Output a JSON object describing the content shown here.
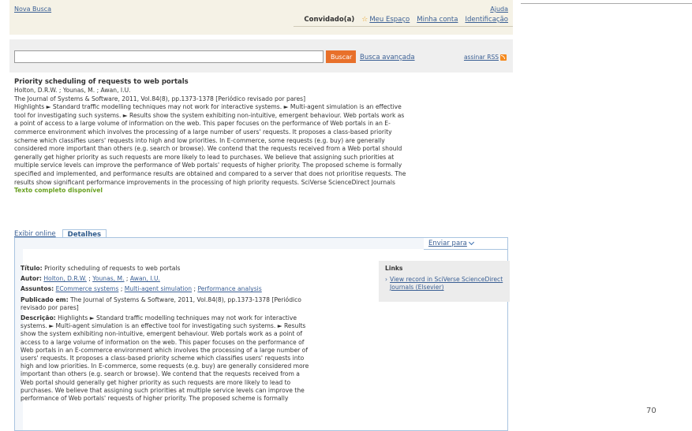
{
  "header": {
    "nova_busca": "Nova Busca",
    "ajuda": "Ajuda",
    "user": "Convidado(a)",
    "meu_espaco": "Meu Espaço",
    "minha_conta": "Minha conta",
    "identificacao": "Identificação"
  },
  "search": {
    "value": "",
    "button": "Buscar",
    "advanced": "Busca avançada",
    "rss": "assinar RSS"
  },
  "record": {
    "title": "Priority scheduling of requests to web portals",
    "authors": "Holton, D.R.W. ; Younas, M. ; Awan, I.U.",
    "source": "The Journal of Systems & Software, 2011, Vol.84(8), pp.1373-1378 [Periódico revisado por pares]",
    "abstract": "Highlights ► Standard traffic modelling techniques may not work for interactive systems. ► Multi-agent simulation is an effective tool for investigating such systems. ► Results show the system exhibiting non-intuitive, emergent behaviour. Web portals work as a point of access to a large volume of information on the web. This paper focuses on the performance of Web portals in an E-commerce environment which involves the processing of a large number of users' requests. It proposes a class-based priority scheme which classifies users' requests into high and low priorities. In E-commerce, some requests (e.g. buy) are generally considered more important than others (e.g. search or browse). We contend that the requests received from a Web portal should generally get higher priority as such requests are more likely to lead to purchases. We believe that assigning such priorities at multiple service levels can improve the performance of Web portals' requests of higher priority. The proposed scheme is formally specified and implemented, and performance results are obtained and compared to a server that does not prioritise requests. The results show significant performance improvements in the processing of high priority requests. SciVerse ScienceDirect Journals",
    "fulltext": "Texto completo disponível"
  },
  "tabs": {
    "online": "Exibir online",
    "details": "Detalhes"
  },
  "enviar": "Enviar para",
  "details": {
    "title_label": "Título:",
    "title_value": "Priority scheduling of requests to web portals",
    "author_label": "Autor:",
    "authors": [
      "Holton, D.R.W.",
      "Younas, M.",
      "Awan, I.U."
    ],
    "subjects_label": "Assuntos:",
    "subjects": [
      "ECommerce systems",
      "Multi-agent simulation",
      "Performance analysis"
    ],
    "published_label": "Publicado em:",
    "published_value": "The Journal of Systems & Software, 2011, Vol.84(8), pp.1373-1378 [Periódico revisado por pares]",
    "desc_label": "Descrição:",
    "desc_value": "Highlights ► Standard traffic modelling techniques may not work for interactive systems. ► Multi-agent simulation is an effective tool for investigating such systems. ► Results show the system exhibiting non-intuitive, emergent behaviour. Web portals work as a point of access to a large volume of information on the web. This paper focuses on the performance of Web portals in an E-commerce environment which involves the processing of a large number of users' requests. It proposes a class-based priority scheme which classifies users' requests into high and low priorities. In E-commerce, some requests (e.g. buy) are generally considered more important than others (e.g. search or browse). We contend that the requests received from a Web portal should generally get higher priority as such requests are more likely to lead to purchases. We believe that assigning such priorities at multiple service levels can improve the performance of Web portals' requests of higher priority. The proposed scheme is formally"
  },
  "links": {
    "heading": "Links",
    "item": "View record in SciVerse ScienceDirect Journals (Elsevier)"
  },
  "page_number": "70"
}
